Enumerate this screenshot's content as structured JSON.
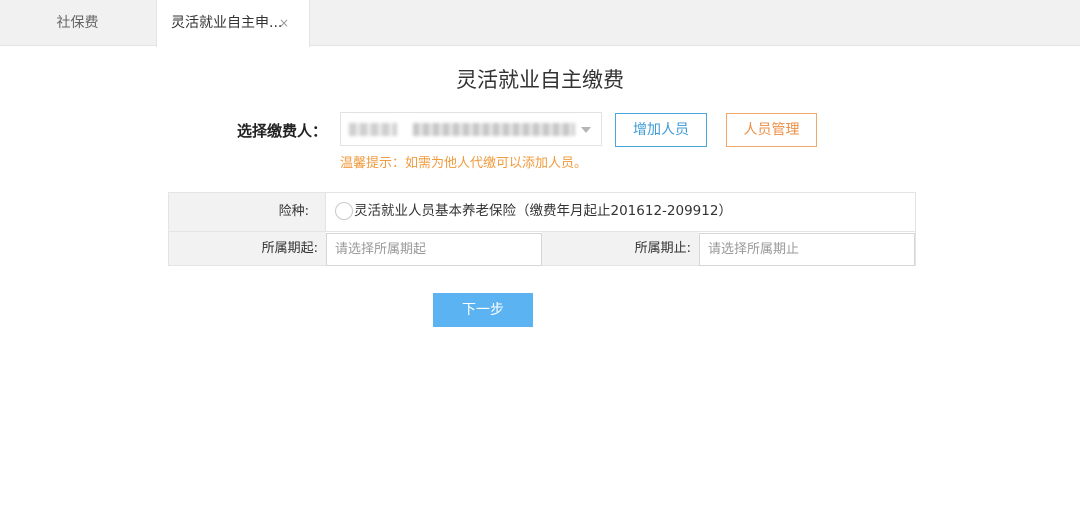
{
  "tabs": [
    {
      "label": "社保费"
    },
    {
      "label": "灵活就业自主申...",
      "close_glyph": "×"
    }
  ],
  "page_title": "灵活就业自主缴费",
  "payer": {
    "label": "选择缴费人：",
    "select_value": "",
    "add_button": "增加人员",
    "manage_button": "人员管理",
    "tip": "温馨提示：如需为他人代缴可以添加人员。"
  },
  "form": {
    "insurance_label": "险种:",
    "insurance_option": "灵活就业人员基本养老保险（缴费年月起止201612-209912）",
    "period_start_label": "所属期起:",
    "period_start_placeholder": "请选择所属期起",
    "period_end_label": "所属期止:",
    "period_end_placeholder": "请选择所属期止"
  },
  "next_button": "下一步",
  "colors": {
    "accent_blue": "#5cb3f2",
    "manage_orange": "#ee8f44",
    "tip_orange": "#f19b3d"
  }
}
